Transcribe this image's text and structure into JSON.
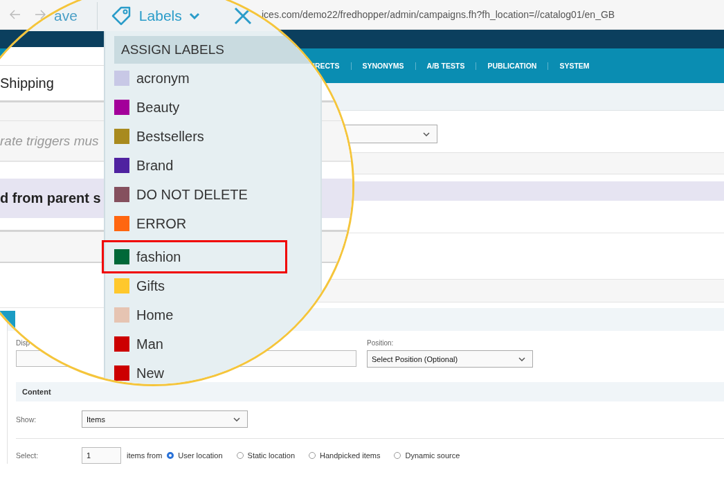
{
  "browser": {
    "url": "ices.com/demo22/fredhopper/admin/campaigns.fh?fh_location=//catalog01/en_GB"
  },
  "nav": [
    "IRECTS",
    "SYNONYMS",
    "A/B TESTS",
    "PUBLICATION",
    "SYSTEM"
  ],
  "magnifier": {
    "toolbar": {
      "save": "ave",
      "labels": "Labels"
    },
    "shipping": "Shipping",
    "hint": "rate triggers mus",
    "inherited": "d from parent s",
    "menu": {
      "title": "ASSIGN LABELS",
      "items": [
        {
          "label": "acronym",
          "color": "#c8c8e6",
          "highlighted": false
        },
        {
          "label": "Beauty",
          "color": "#a3009a",
          "highlighted": false
        },
        {
          "label": "Bestsellers",
          "color": "#a88a1e",
          "highlighted": false
        },
        {
          "label": "Brand",
          "color": "#4f22a0",
          "highlighted": false
        },
        {
          "label": "DO NOT DELETE",
          "color": "#85505e",
          "highlighted": false
        },
        {
          "label": "ERROR",
          "color": "#ff6610",
          "highlighted": false
        },
        {
          "label": "fashion",
          "color": "#006838",
          "highlighted": true
        },
        {
          "label": "Gifts",
          "color": "#ffc82c",
          "highlighted": false
        },
        {
          "label": "Home",
          "color": "#e6c4b2",
          "highlighted": false
        },
        {
          "label": "Man",
          "color": "#cc0000",
          "highlighted": false
        },
        {
          "label": "New",
          "color": "#cc0000",
          "highlighted": false
        }
      ]
    }
  },
  "form": {
    "display_label": "Disp",
    "position_label": "Position:",
    "position_select": "Select Position (Optional)",
    "section": "Content",
    "show_label": "Show:",
    "show_select": "Items",
    "select_label": "Select:",
    "count": "1",
    "items_from": "items from",
    "sources": [
      {
        "label": "User location",
        "selected": true
      },
      {
        "label": "Static location",
        "selected": false
      },
      {
        "label": "Handpicked items",
        "selected": false
      },
      {
        "label": "Dynamic source",
        "selected": false
      }
    ]
  }
}
